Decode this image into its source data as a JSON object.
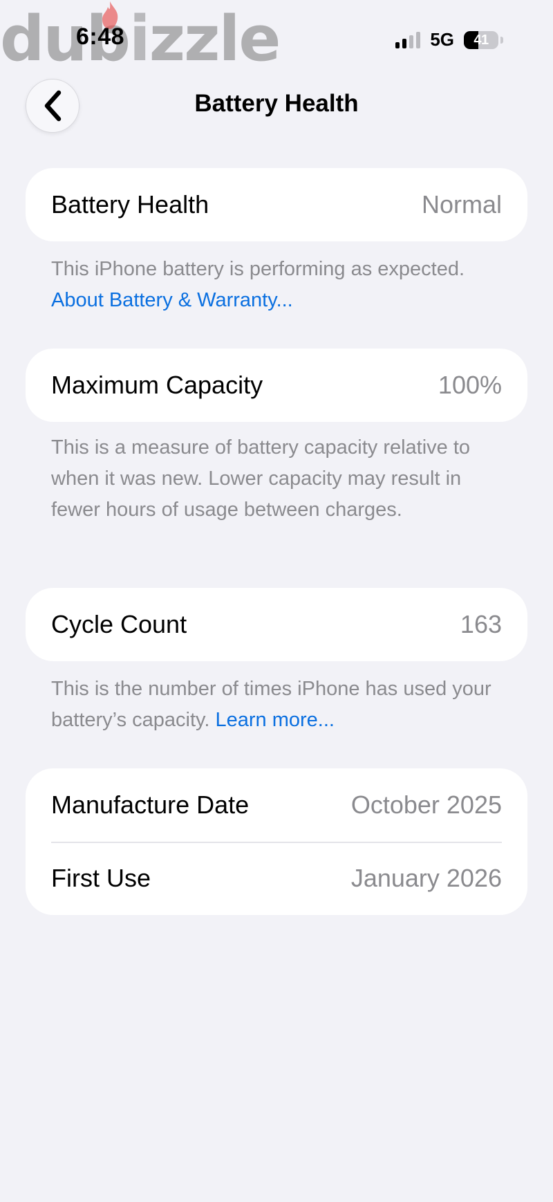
{
  "status_bar": {
    "time": "6:48",
    "network": "5G",
    "battery_level": "41",
    "watermark": "dubizzle"
  },
  "nav": {
    "title": "Battery Health",
    "back_icon": "chevron-left-icon"
  },
  "sections": {
    "health": {
      "label": "Battery Health",
      "value": "Normal",
      "footer_text": "This iPhone battery is performing as expected. ",
      "footer_link": "About Battery & Warranty..."
    },
    "capacity": {
      "label": "Maximum Capacity",
      "value": "100%",
      "footer_text": "This is a measure of battery capacity relative to when it was new. Lower capacity may result in fewer hours of usage between charges."
    },
    "cycles": {
      "label": "Cycle Count",
      "value": "163",
      "footer_text": "This is the number of times iPhone has used your battery’s capacity. ",
      "footer_link": "Learn more..."
    },
    "dates": {
      "manufacture_label": "Manufacture Date",
      "manufacture_value": "October 2025",
      "first_use_label": "First Use",
      "first_use_value": "January 2026"
    }
  },
  "colors": {
    "background": "#f2f2f7",
    "card": "#ffffff",
    "link": "#0a6fe0",
    "secondary_text": "#8a8a8e"
  }
}
